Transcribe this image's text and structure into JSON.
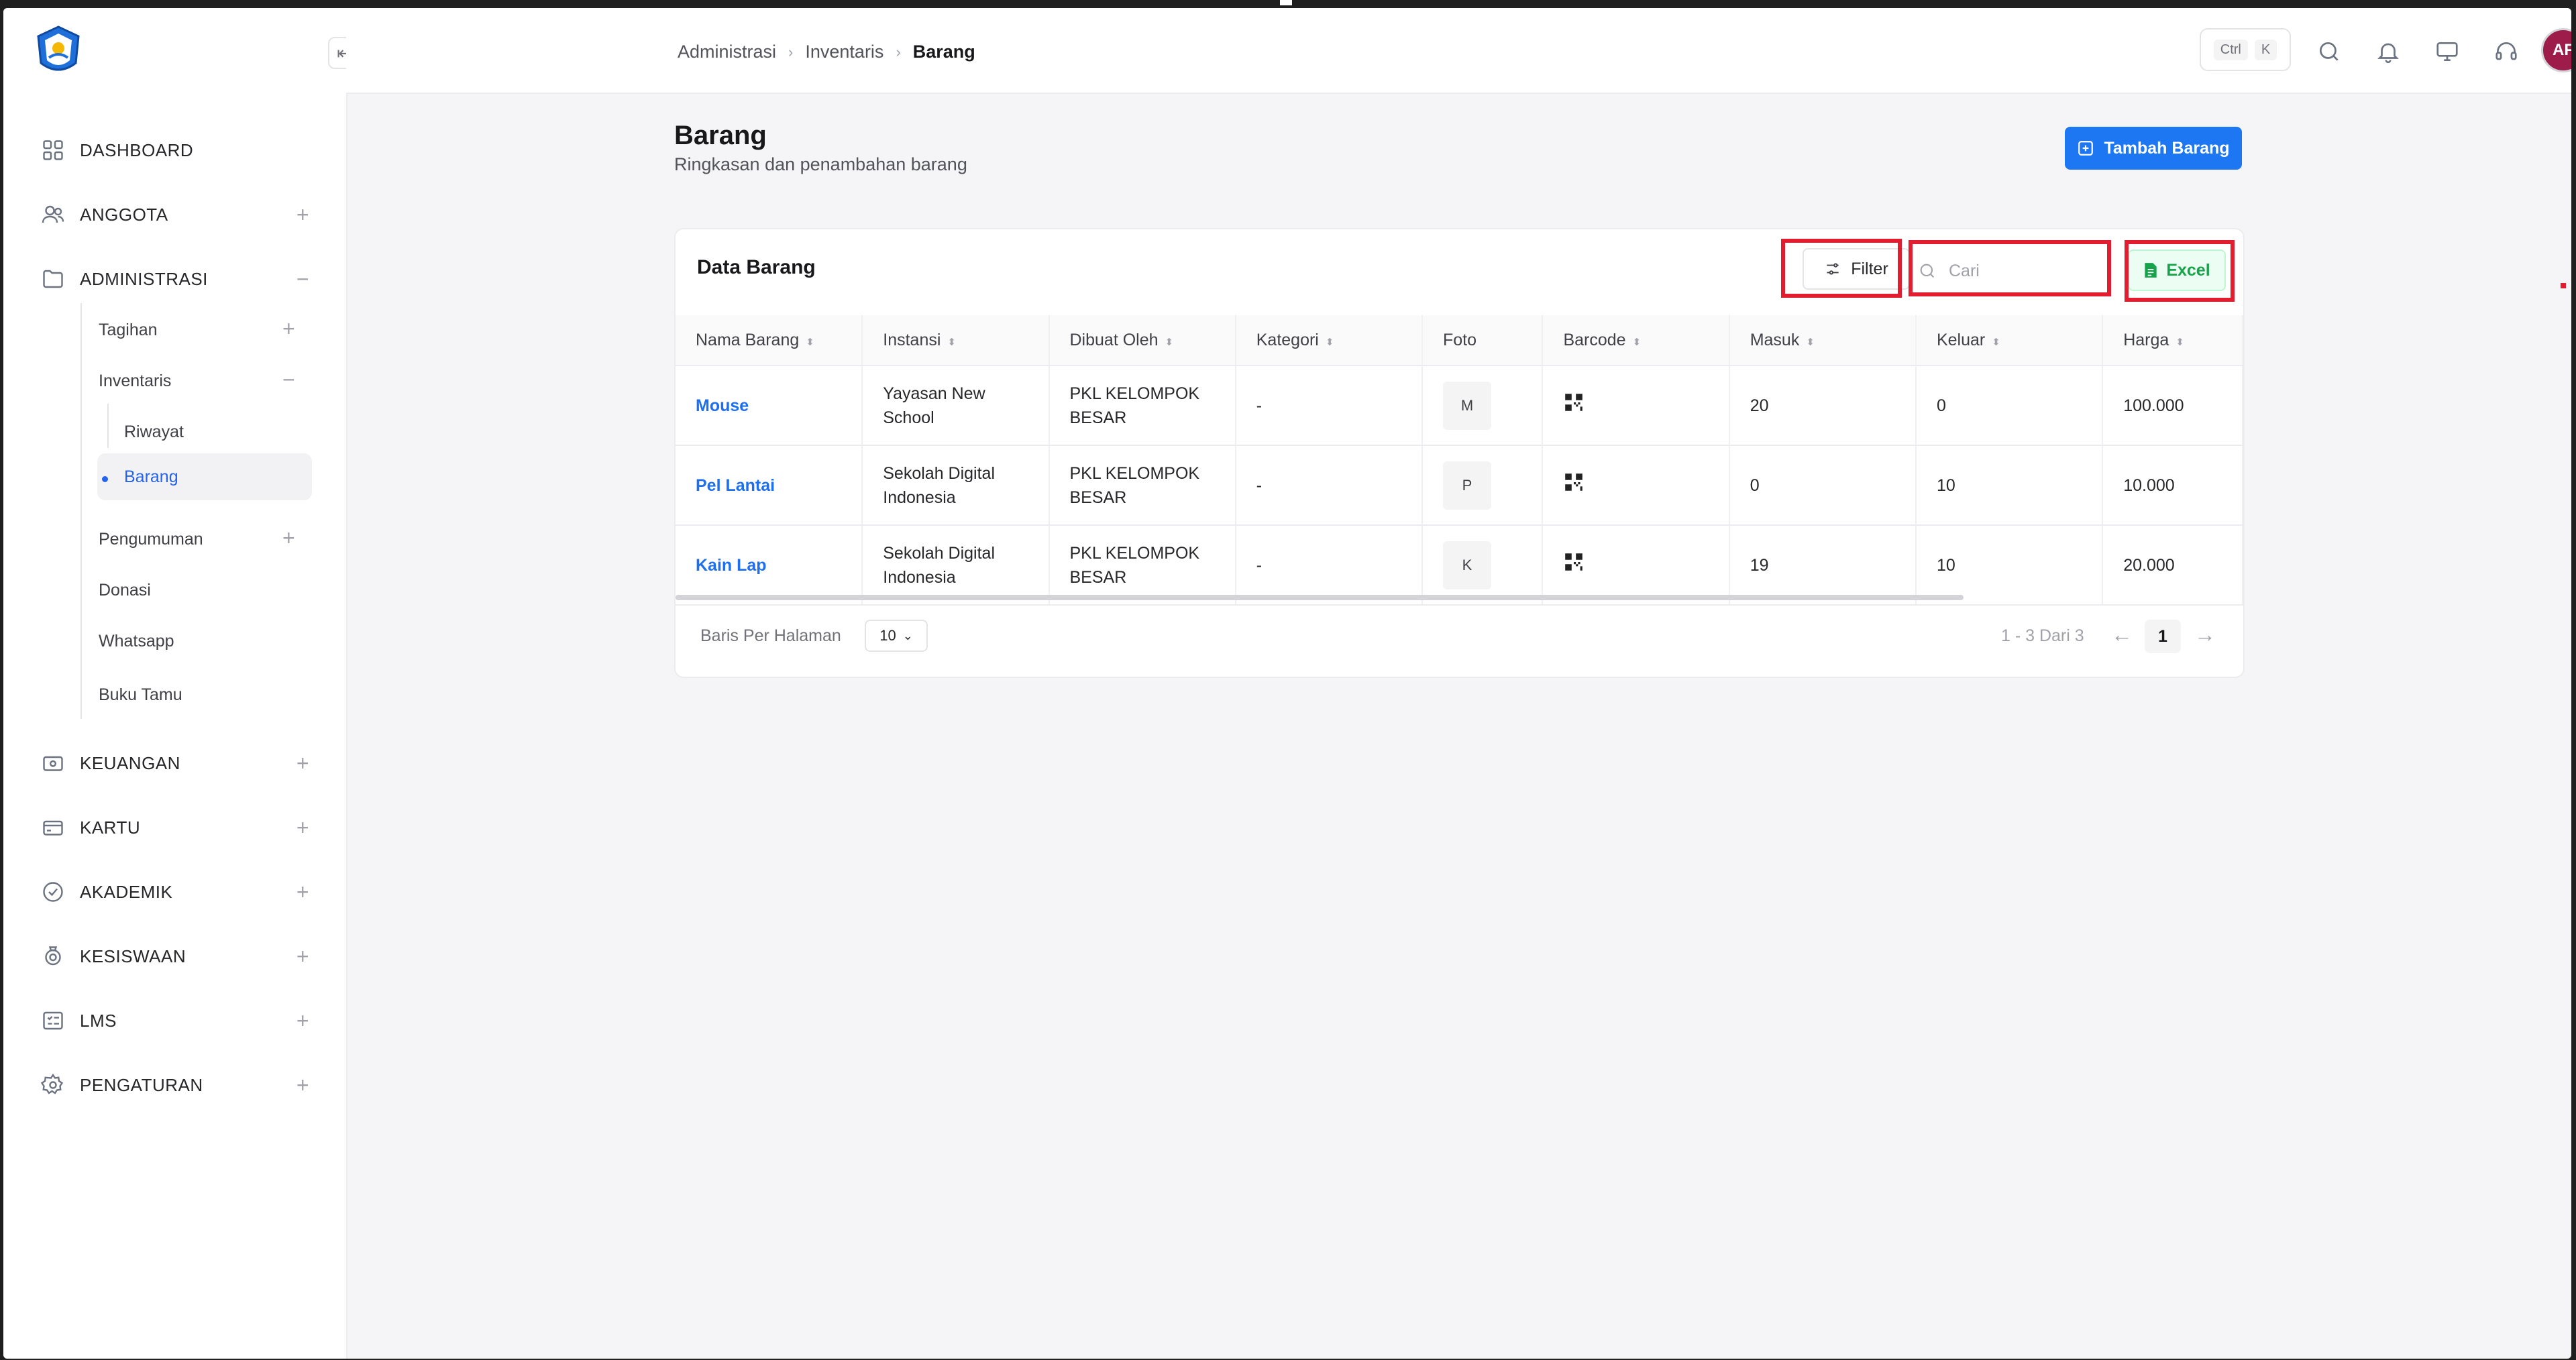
{
  "breadcrumb": [
    "Administrasi",
    "Inventaris",
    "Barang"
  ],
  "shortcut": {
    "ctrl": "Ctrl",
    "key": "K"
  },
  "user": {
    "initials": "AF"
  },
  "sidebar": {
    "items": [
      {
        "label": "DASHBOARD",
        "icon": "grid-icon"
      },
      {
        "label": "ANGGOTA",
        "icon": "users-icon",
        "expand": "+"
      },
      {
        "label": "ADMINISTRASI",
        "icon": "folder-icon",
        "expand": "−"
      },
      {
        "label": "KEUANGAN",
        "icon": "wallet-icon",
        "expand": "+"
      },
      {
        "label": "KARTU",
        "icon": "card-icon",
        "expand": "+"
      },
      {
        "label": "AKADEMIK",
        "icon": "academic-icon",
        "expand": "+"
      },
      {
        "label": "KESISWAAN",
        "icon": "student-icon",
        "expand": "+"
      },
      {
        "label": "LMS",
        "icon": "checklist-icon",
        "expand": "+"
      },
      {
        "label": "PENGATURAN",
        "icon": "gear-icon",
        "expand": "+"
      }
    ],
    "administrasi_sub": {
      "tagihan": "Tagihan",
      "inventaris": "Inventaris",
      "riwayat": "Riwayat",
      "barang": "Barang",
      "pengumuman": "Pengumuman",
      "donasi": "Donasi",
      "whatsapp": "Whatsapp",
      "buku_tamu": "Buku Tamu"
    }
  },
  "page": {
    "title": "Barang",
    "subtitle": "Ringkasan dan penambahan barang",
    "add_button": "Tambah Barang"
  },
  "table_card": {
    "title": "Data Barang",
    "filter_label": "Filter",
    "search_placeholder": "Cari",
    "excel_label": "Excel",
    "columns": [
      "Nama Barang",
      "Instansi",
      "Dibuat Oleh",
      "Kategori",
      "Foto",
      "Barcode",
      "Masuk",
      "Keluar",
      "Harga"
    ],
    "rows": [
      {
        "nama": "Mouse",
        "instansi": "Yayasan New School",
        "dibuat_oleh": "PKL KELOMPOK BESAR",
        "kategori": "-",
        "foto": "M",
        "masuk": "20",
        "keluar": "0",
        "harga": "100.000"
      },
      {
        "nama": "Pel Lantai",
        "instansi": "Sekolah Digital Indonesia",
        "dibuat_oleh": "PKL KELOMPOK BESAR",
        "kategori": "-",
        "foto": "P",
        "masuk": "0",
        "keluar": "10",
        "harga": "10.000"
      },
      {
        "nama": "Kain Lap",
        "instansi": "Sekolah Digital Indonesia",
        "dibuat_oleh": "PKL KELOMPOK BESAR",
        "kategori": "-",
        "foto": "K",
        "masuk": "19",
        "keluar": "10",
        "harga": "20.000"
      }
    ],
    "rows_per_page_label": "Baris Per Halaman",
    "rows_per_page_value": "10",
    "range_text": "1 - 3 Dari 3",
    "current_page": "1"
  },
  "colors": {
    "primary": "#1e77f2",
    "excel": "#16a34a",
    "highlight": "#e11d2f",
    "avatar": "#9d1c4a"
  }
}
